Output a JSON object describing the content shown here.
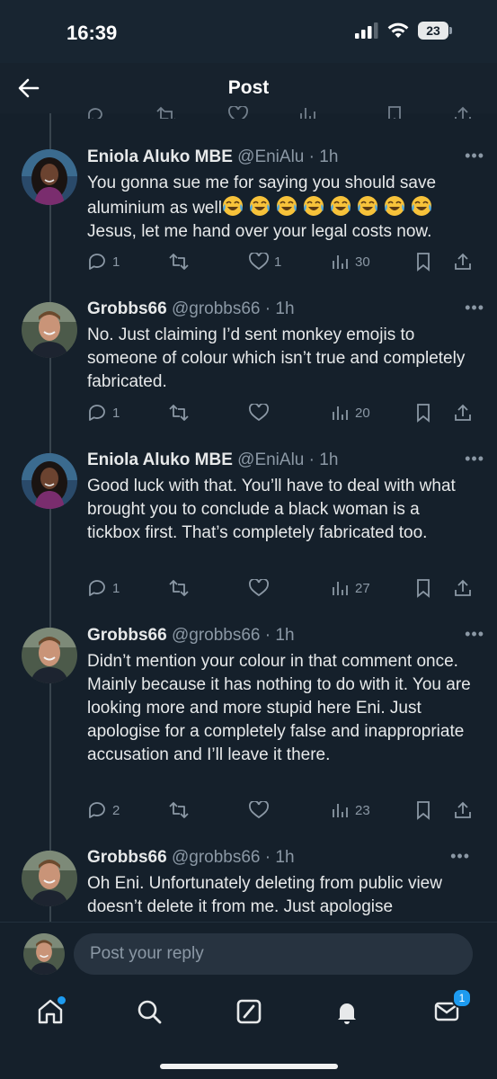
{
  "status": {
    "time": "16:39",
    "battery": "23"
  },
  "header": {
    "title": "Post",
    "back_icon": "arrow-left-icon"
  },
  "colors": {
    "background": "#15202b",
    "text": "#e7e9ea",
    "muted": "#8b98a5",
    "accent": "#1d9bf0"
  },
  "tweets": [
    {
      "name": "Eniola Aluko MBE",
      "handle": "@EniAlu",
      "time": "1h",
      "text": "You gonna sue me for saying you should save aluminium as well",
      "emoji_count": 8,
      "emoji_name": "face-with-tears-of-joy-icon",
      "text_after": "Jesus, let me hand over your legal costs now.",
      "replies": "1",
      "likes": "1",
      "views": "30",
      "liked": false
    },
    {
      "name": "Grobbs66",
      "handle": "@grobbs66",
      "time": "1h",
      "text": "No. Just claiming I’d sent monkey emojis to someone of colour which isn’t true and completely fabricated.",
      "replies": "1",
      "likes": "",
      "views": "20"
    },
    {
      "name": "Eniola Aluko MBE",
      "handle": "@EniAlu",
      "time": "1h",
      "text": "Good luck with that. You’ll have to deal with what brought you to conclude a black woman is a tickbox first. That’s completely fabricated too.",
      "replies": "1",
      "likes": "",
      "views": "27"
    },
    {
      "name": "Grobbs66",
      "handle": "@grobbs66",
      "time": "1h",
      "text": "Didn’t mention your colour in that comment once. Mainly because it has nothing to do with it. You are looking more and more stupid here Eni. Just apologise for a completely false and inappropriate accusation and I’ll leave it there.",
      "replies": "2",
      "likes": "",
      "views": "23"
    },
    {
      "name": "Grobbs66",
      "handle": "@grobbs66",
      "time": "1h",
      "text": "Oh Eni. Unfortunately deleting from public view doesn’t delete it from me. Just apologise"
    }
  ],
  "composer": {
    "placeholder": "Post your reply"
  },
  "tabbar": {
    "items": [
      "home-icon",
      "search-icon",
      "grok-icon",
      "notifications-bell-icon",
      "messages-mail-icon"
    ],
    "messages_badge": "1"
  }
}
